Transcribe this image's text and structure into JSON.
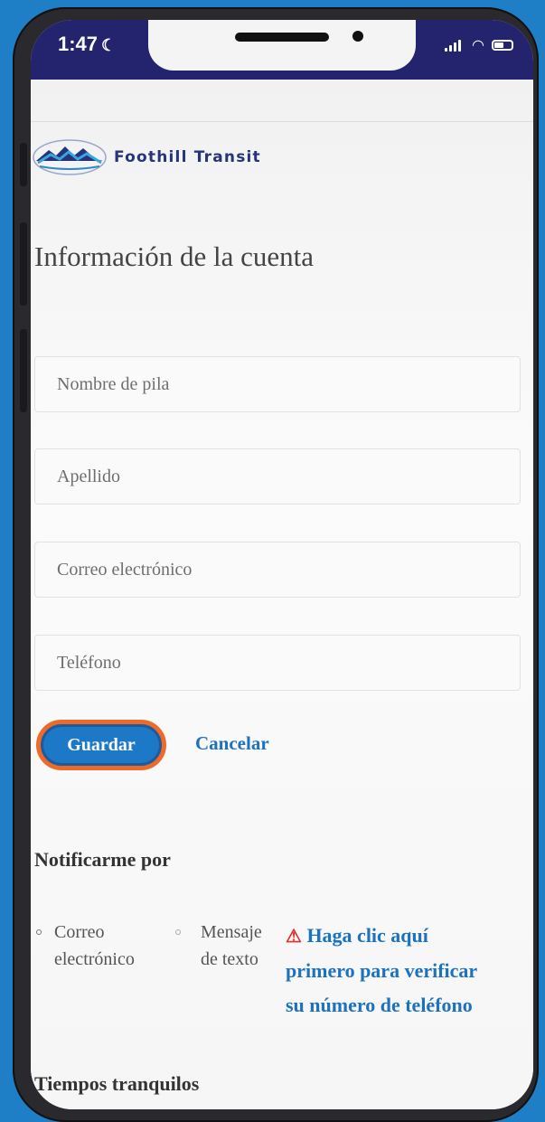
{
  "status_bar": {
    "time": "1:47"
  },
  "brand": {
    "name": "Foothill Transit",
    "color": "#26347a"
  },
  "page_title": "Información de la cuenta",
  "form": {
    "first_name_placeholder": "Nombre de pila",
    "last_name_placeholder": "Apellido",
    "email_placeholder": "Correo electrónico",
    "phone_placeholder": "Teléfono"
  },
  "actions": {
    "save_label": "Guardar",
    "cancel_label": "Cancelar"
  },
  "notifications": {
    "heading": "Notificarme por",
    "option_email_line1": "Correo",
    "option_email_line2": "electrónico",
    "option_text_line1": "Mensaje",
    "option_text_line2": "de texto",
    "verify_line1": "Haga clic aquí",
    "verify_line2": "primero para verificar",
    "verify_line3": "su número de teléfono"
  },
  "quiet_times_heading": "Tiempos tranquilos",
  "colors": {
    "accent": "#1d72bf",
    "status_bar": "#23236e",
    "highlight_ring": "#ee6a2a",
    "background": "#1f7fc6"
  }
}
